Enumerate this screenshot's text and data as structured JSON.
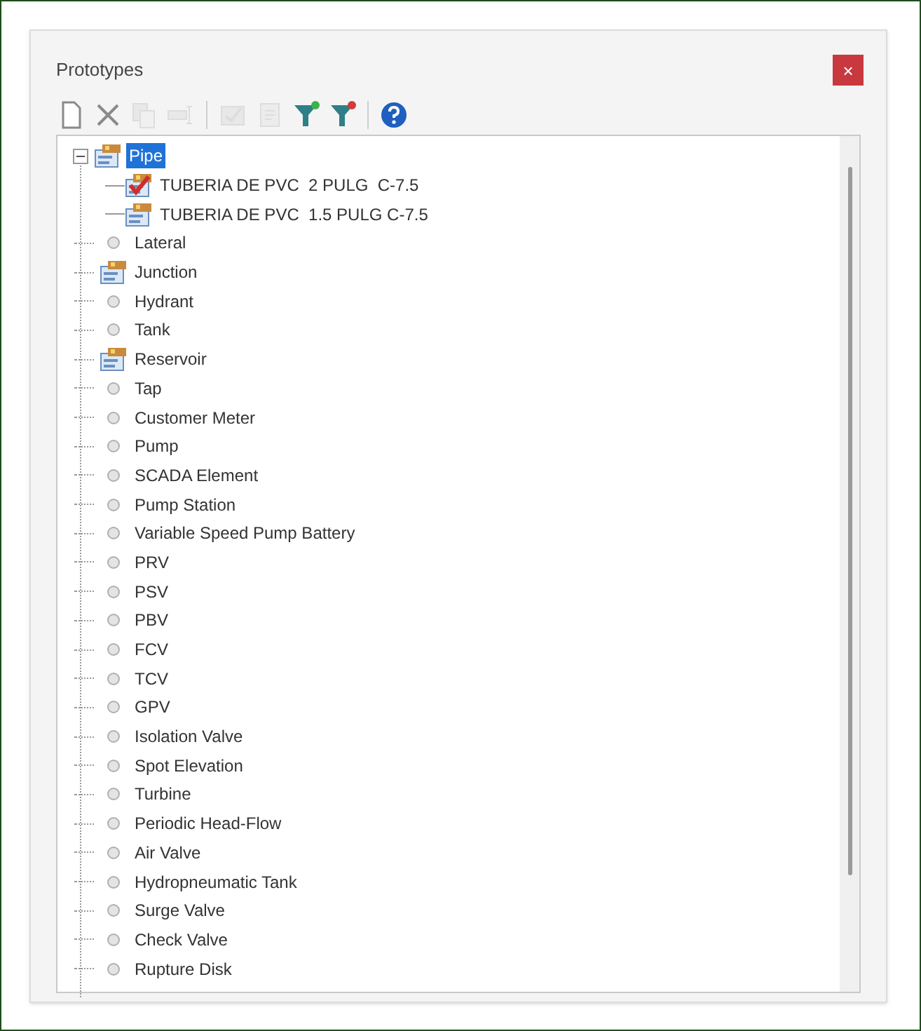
{
  "window": {
    "title": "Prototypes",
    "close_button": "×"
  },
  "toolbar": [
    {
      "kind": "new",
      "disabled": false
    },
    {
      "kind": "delete",
      "disabled": false
    },
    {
      "kind": "copy",
      "disabled": true
    },
    {
      "kind": "rename",
      "disabled": true
    },
    {
      "kind": "separator"
    },
    {
      "kind": "set-default",
      "disabled": true
    },
    {
      "kind": "report",
      "disabled": true
    },
    {
      "kind": "filter-add",
      "disabled": false
    },
    {
      "kind": "filter-remove",
      "disabled": false
    },
    {
      "kind": "separator"
    },
    {
      "kind": "help",
      "disabled": false
    }
  ],
  "tree": [
    {
      "label": "Pipe",
      "kind": "group",
      "selected": true,
      "expanded": true,
      "children": [
        {
          "label": "TUBERIA DE PVC  2 PULG  C-7.5",
          "kind": "default",
          "selected": false
        },
        {
          "label": "TUBERIA DE PVC  1.5 PULG C-7.5",
          "kind": "prototype",
          "selected": false
        }
      ]
    },
    {
      "label": "Lateral",
      "kind": "empty",
      "selected": false
    },
    {
      "label": "Junction",
      "kind": "group",
      "selected": false
    },
    {
      "label": "Hydrant",
      "kind": "empty",
      "selected": false
    },
    {
      "label": "Tank",
      "kind": "empty",
      "selected": false
    },
    {
      "label": "Reservoir",
      "kind": "group",
      "selected": false
    },
    {
      "label": "Tap",
      "kind": "empty",
      "selected": false
    },
    {
      "label": "Customer Meter",
      "kind": "empty",
      "selected": false
    },
    {
      "label": "Pump",
      "kind": "empty",
      "selected": false
    },
    {
      "label": "SCADA Element",
      "kind": "empty",
      "selected": false
    },
    {
      "label": "Pump Station",
      "kind": "empty",
      "selected": false
    },
    {
      "label": "Variable Speed Pump Battery",
      "kind": "empty",
      "selected": false
    },
    {
      "label": "PRV",
      "kind": "empty",
      "selected": false
    },
    {
      "label": "PSV",
      "kind": "empty",
      "selected": false
    },
    {
      "label": "PBV",
      "kind": "empty",
      "selected": false
    },
    {
      "label": "FCV",
      "kind": "empty",
      "selected": false
    },
    {
      "label": "TCV",
      "kind": "empty",
      "selected": false
    },
    {
      "label": "GPV",
      "kind": "empty",
      "selected": false
    },
    {
      "label": "Isolation Valve",
      "kind": "empty",
      "selected": false
    },
    {
      "label": "Spot Elevation",
      "kind": "empty",
      "selected": false
    },
    {
      "label": "Turbine",
      "kind": "empty",
      "selected": false
    },
    {
      "label": "Periodic Head-Flow",
      "kind": "empty",
      "selected": false
    },
    {
      "label": "Air Valve",
      "kind": "empty",
      "selected": false
    },
    {
      "label": "Hydropneumatic Tank",
      "kind": "empty",
      "selected": false
    },
    {
      "label": "Surge Valve",
      "kind": "empty",
      "selected": false
    },
    {
      "label": "Check Valve",
      "kind": "empty",
      "selected": false
    },
    {
      "label": "Rupture Disk",
      "kind": "empty",
      "selected": false
    }
  ]
}
